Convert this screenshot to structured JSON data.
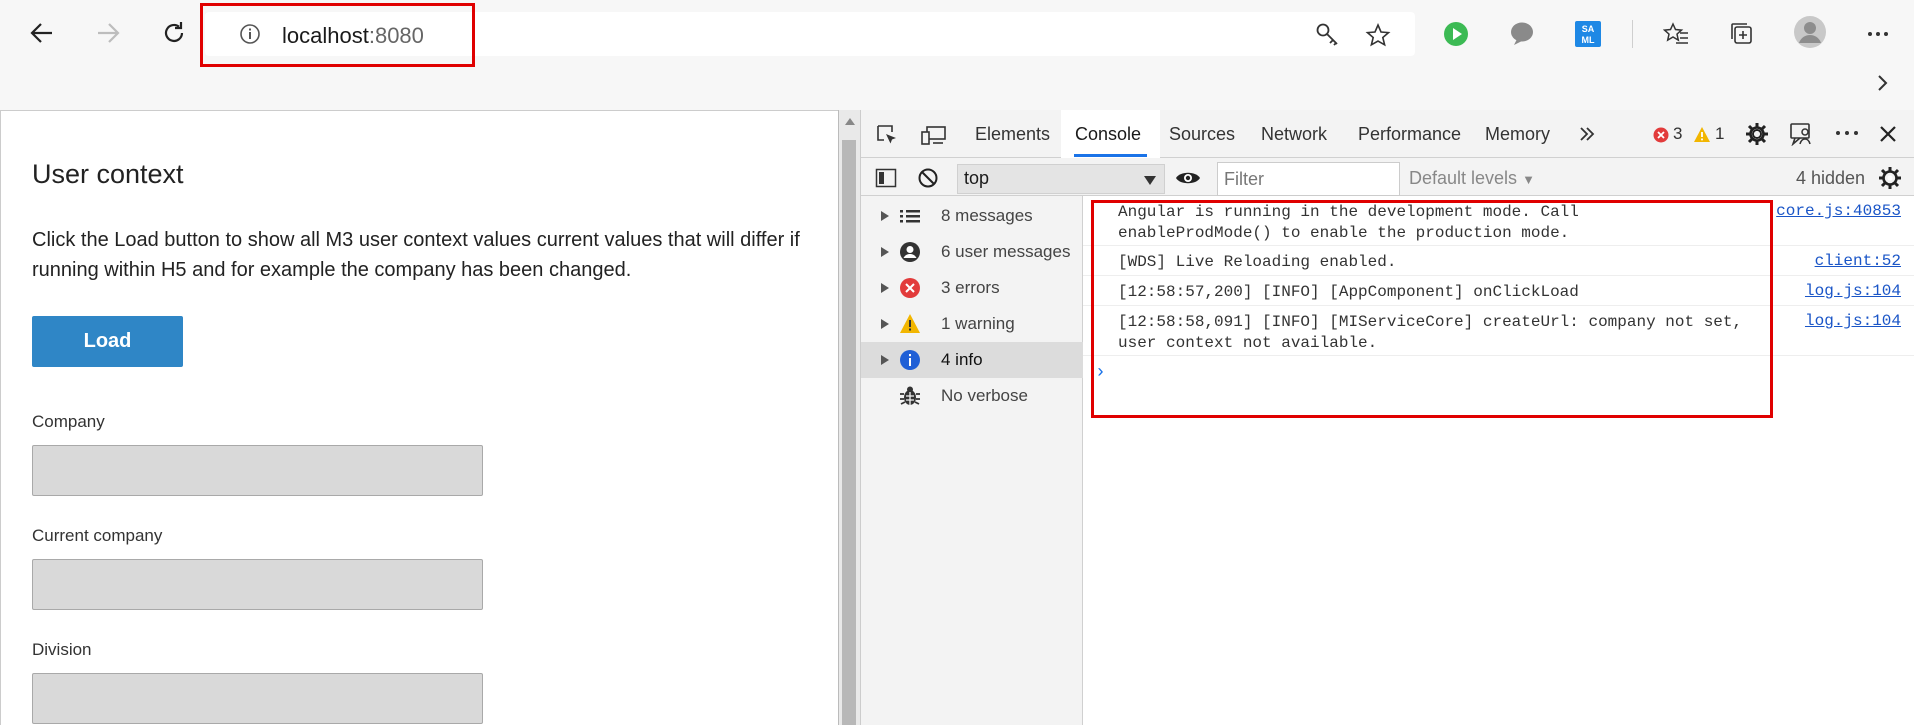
{
  "browser": {
    "address": {
      "host": "localhost",
      "port": ":8080"
    }
  },
  "page": {
    "title": "User context",
    "description": "Click the Load button to show all M3 user context values current values that will differ if running within H5 and for example the company has been changed.",
    "load_label": "Load",
    "fields": [
      {
        "label": "Company",
        "value": ""
      },
      {
        "label": "Current company",
        "value": ""
      },
      {
        "label": "Division",
        "value": ""
      }
    ]
  },
  "devtools": {
    "tabs": [
      "Elements",
      "Console",
      "Sources",
      "Network",
      "Performance",
      "Memory"
    ],
    "active_tab": "Console",
    "error_count": "3",
    "warning_count": "1",
    "context": "top",
    "filter_placeholder": "Filter",
    "levels_label": "Default levels",
    "hidden_label": "4 hidden",
    "sidebar": [
      {
        "label": "8 messages",
        "icon": "list-icon"
      },
      {
        "label": "6 user messages",
        "icon": "user-icon"
      },
      {
        "label": "3 errors",
        "icon": "error-icon"
      },
      {
        "label": "1 warning",
        "icon": "warning-icon"
      },
      {
        "label": "4 info",
        "icon": "info-icon"
      },
      {
        "label": "No verbose",
        "icon": "bug-icon"
      }
    ],
    "messages": [
      {
        "text": "Angular is running in the development mode. Call\nenableProdMode() to enable the production mode.",
        "source": "core.js:40853"
      },
      {
        "text": "[WDS] Live Reloading enabled.",
        "source": "client:52"
      },
      {
        "text": "[12:58:57,200] [INFO] [AppComponent] onClickLoad",
        "source": "log.js:104"
      },
      {
        "text": "[12:58:58,091] [INFO] [MIServiceCore] createUrl: company not set,\nuser context not available.",
        "source": "log.js:104"
      }
    ],
    "prompt": "›"
  },
  "colors": {
    "accent": "#2f86c6",
    "highlight": "#e00000",
    "link": "#1a55c7"
  }
}
